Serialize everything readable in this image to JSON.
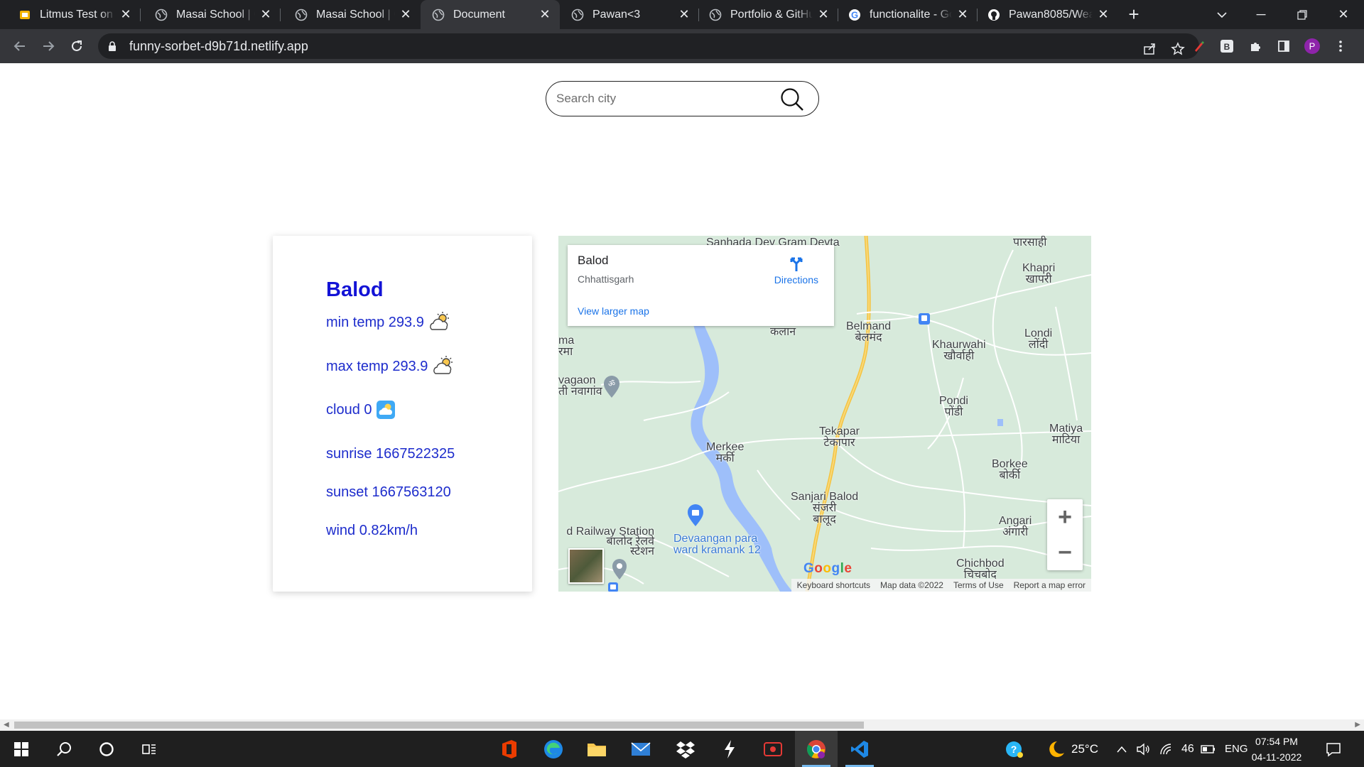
{
  "browser": {
    "tabs": [
      {
        "title": "Litmus Test on OJ",
        "icon": "slides-icon"
      },
      {
        "title": "Masai School | Co",
        "icon": "globe-icon"
      },
      {
        "title": "Masai School | Co",
        "icon": "globe-icon"
      },
      {
        "title": "Document",
        "icon": "globe-icon",
        "active": true
      },
      {
        "title": "Pawan<3",
        "icon": "globe-icon"
      },
      {
        "title": "Portfolio & GitHu",
        "icon": "globe-icon"
      },
      {
        "title": "functionalite - Go",
        "icon": "google-icon"
      },
      {
        "title": "Pawan8085/Weat",
        "icon": "github-icon"
      }
    ],
    "url": "funny-sorbet-d9b71d.netlify.app",
    "profile_initial": "P",
    "extension_badge": "B"
  },
  "search": {
    "placeholder": "Search city"
  },
  "weather": {
    "city": "Balod",
    "min_temp": "min temp 293.9",
    "max_temp": "max temp 293.9",
    "cloud": "cloud 0",
    "sunrise": "sunrise 1667522325",
    "sunset": "sunset 1667563120",
    "wind": "wind 0.82km/h"
  },
  "map": {
    "place_title": "Balod",
    "place_subtitle": "Chhattisgarh",
    "directions_label": "Directions",
    "larger_map_link": "View larger map",
    "labels": {
      "sanhada": "Sanhada Dev Gram Devta",
      "parsahi": "पारसाही",
      "khapri": "Khapri\nखापरी",
      "belmand": "Belmand\nबेलमंद",
      "kalan": "कलान",
      "ma": "ma\nरमा",
      "khaurwahi": "Khaurwahi\nखौर्वाही",
      "londi": "Londi\nलोंदी",
      "vagaon": "vagaon\nती नवागांव",
      "pondi": "Pondi\nपोंडी",
      "matiya": "Matiya\nमाटिया",
      "tekapar": "Tekapar\nटेकापार",
      "merkee": "Merkee\nमर्की",
      "borkee": "Borkee\nबोर्की",
      "sanjari": "Sanjari Balod\nसंजरी\nबालूद",
      "angari": "Angari\nअंगारी",
      "railway": "d Railway Station\nबालोद रेलवे\nस्टेशन",
      "devaangan": "Devaangan para\nward kramank 12",
      "chichbod": "Chichbod\nचिचबोद"
    },
    "google_logo": "Google",
    "footer": {
      "shortcuts": "Keyboard shortcuts",
      "data": "Map data ©2022",
      "terms": "Terms of Use",
      "report": "Report a map error"
    }
  },
  "taskbar": {
    "temperature": "25°C",
    "network_count": "46",
    "language": "ENG",
    "time": "07:54 PM",
    "date": "04-11-2022"
  }
}
